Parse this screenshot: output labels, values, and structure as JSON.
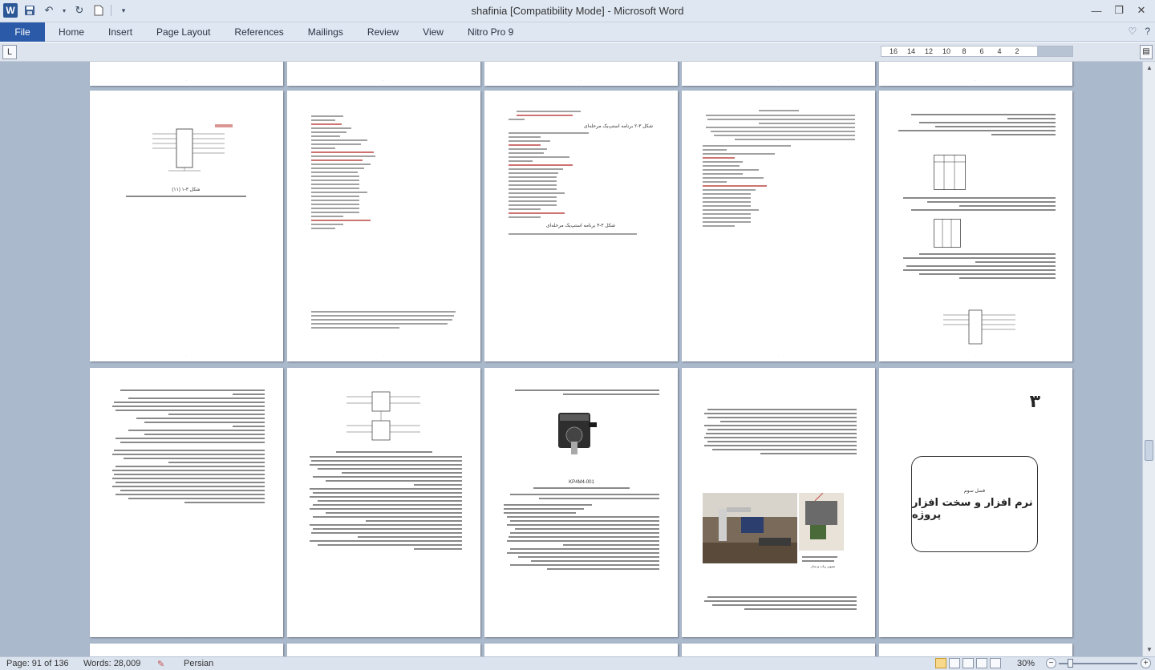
{
  "window": {
    "title": "shafinia [Compatibility Mode]  -  Microsoft Word",
    "app_icon": "W"
  },
  "ribbon": {
    "file_tab": "File",
    "tabs": [
      "Home",
      "Insert",
      "Page Layout",
      "References",
      "Mailings",
      "Review",
      "View",
      "Nitro Pro 9"
    ]
  },
  "ruler": {
    "ticks": [
      "16",
      "14",
      "12",
      "10",
      "8",
      "6",
      "4",
      "2",
      "",
      "2"
    ]
  },
  "pages": {
    "chapter": {
      "number": "۳",
      "subtitle": "فصل سوم",
      "title": "نرم افزار و سخت افزار پروژه"
    },
    "figure_captions": {
      "schematic_1": "شکل ۳-۱ (۱۱)",
      "code_1": "شکل ۳-۲ برنامه استپ‌یک مرحله‌ای",
      "code_2": "شکل ۳-۳ برنامه استپ‌یک مرحله‌ای",
      "motor": "KP4M4-001",
      "robot": "تصویر ربات و مدار"
    }
  },
  "status": {
    "page": "Page: 91 of 136",
    "words": "Words: 28,009",
    "language": "Persian",
    "zoom": "30%"
  }
}
